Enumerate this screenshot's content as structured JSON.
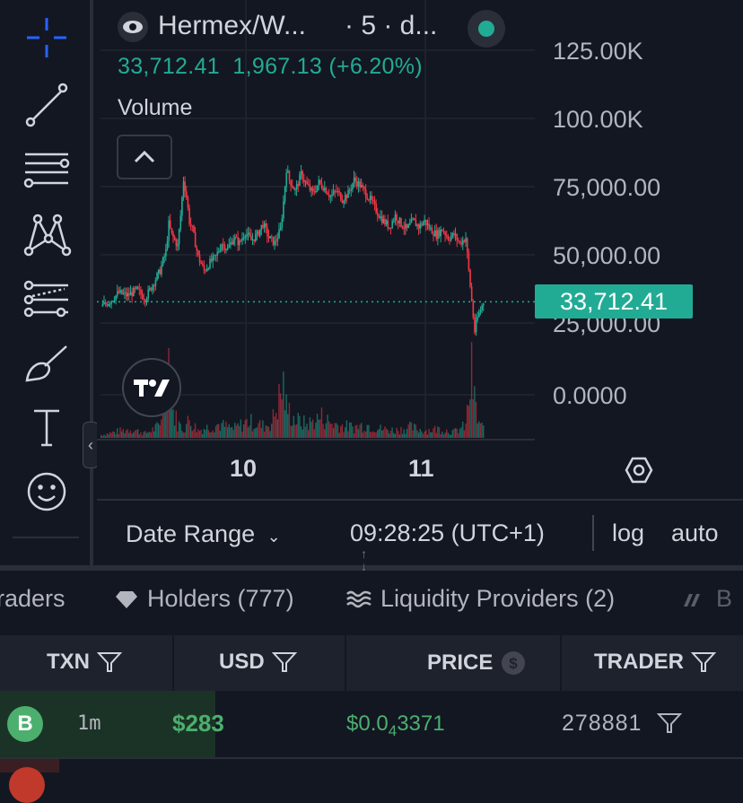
{
  "header": {
    "symbol": "Hermex/W...",
    "interval": "· 5 · d...",
    "price": "33,712.41",
    "change": "1,967.13 (+6.20%)",
    "volume_label": "Volume"
  },
  "y_axis": {
    "labels": [
      "125.00K",
      "100.00K",
      "75,000.00",
      "50,000.00",
      "25,000.00",
      "0.0000"
    ],
    "last_price_tag": "33,712.41"
  },
  "x_axis": {
    "labels": [
      "10",
      "11"
    ]
  },
  "bottom_bar": {
    "date_range": "Date Range",
    "time": "09:28:25 (UTC+1)",
    "log": "log",
    "auto": "auto"
  },
  "tabs": [
    {
      "label": "raders"
    },
    {
      "label": "Holders (777)"
    },
    {
      "label": "Liquidity Providers (2)"
    },
    {
      "label": "B"
    }
  ],
  "table": {
    "columns": [
      "TXN",
      "USD",
      "PRICE",
      "TRADER"
    ],
    "rows": [
      {
        "side": "B",
        "age": "1m",
        "usd": "$283",
        "price_main": "$0.0",
        "price_sub": "4",
        "price_tail": "3371",
        "trader": "278881"
      }
    ]
  },
  "colors": {
    "background": "#131722",
    "up": "#22ab94",
    "down": "#f23645",
    "buy": "#4caf6e",
    "accent_blue": "#2962ff"
  },
  "icons": {
    "toolbar": [
      "crosshair-icon",
      "trend-line-icon",
      "fib-retracement-icon",
      "pattern-icon",
      "prediction-icon",
      "brush-icon",
      "text-icon",
      "emoji-icon"
    ]
  },
  "chart_data": {
    "type": "candlestick",
    "title": "",
    "xlabel": "",
    "ylabel": "",
    "x_ticks": [
      "10",
      "11"
    ],
    "ylim": [
      0,
      125000
    ],
    "last_price": 33712.41,
    "price_path": [
      [
        0,
        32000
      ],
      [
        3,
        34000
      ],
      [
        6,
        37000
      ],
      [
        9,
        36000
      ],
      [
        12,
        38000
      ],
      [
        15,
        35000
      ],
      [
        18,
        41000
      ],
      [
        20,
        45000
      ],
      [
        22,
        52000
      ],
      [
        23,
        62000
      ],
      [
        24,
        58000
      ],
      [
        26,
        54000
      ],
      [
        27,
        65000
      ],
      [
        28,
        78000
      ],
      [
        29,
        72000
      ],
      [
        30,
        63000
      ],
      [
        31,
        60000
      ],
      [
        33,
        50000
      ],
      [
        35,
        45000
      ],
      [
        37,
        48000
      ],
      [
        39,
        50000
      ],
      [
        41,
        55000
      ],
      [
        43,
        53000
      ],
      [
        45,
        57000
      ],
      [
        47,
        55000
      ],
      [
        49,
        59000
      ],
      [
        51,
        56000
      ],
      [
        53,
        58000
      ],
      [
        55,
        62000
      ],
      [
        57,
        57000
      ],
      [
        59,
        55000
      ],
      [
        61,
        60000
      ],
      [
        62,
        70000
      ],
      [
        63,
        82000
      ],
      [
        64,
        78000
      ],
      [
        66,
        74000
      ],
      [
        68,
        80000
      ],
      [
        70,
        76000
      ],
      [
        72,
        73000
      ],
      [
        74,
        77000
      ],
      [
        76,
        75000
      ],
      [
        78,
        72000
      ],
      [
        80,
        74000
      ],
      [
        82,
        71000
      ],
      [
        84,
        73000
      ],
      [
        86,
        78000
      ],
      [
        88,
        76000
      ],
      [
        90,
        73000
      ],
      [
        92,
        70000
      ],
      [
        94,
        66000
      ],
      [
        96,
        63000
      ],
      [
        98,
        61000
      ],
      [
        100,
        65000
      ],
      [
        102,
        62000
      ],
      [
        104,
        60000
      ],
      [
        106,
        63000
      ],
      [
        108,
        61000
      ],
      [
        110,
        63000
      ],
      [
        112,
        60000
      ],
      [
        114,
        58000
      ],
      [
        116,
        60000
      ],
      [
        118,
        57000
      ],
      [
        120,
        58000
      ],
      [
        122,
        55000
      ],
      [
        124,
        57000
      ],
      [
        125,
        45000
      ],
      [
        126,
        34000
      ],
      [
        127,
        23000
      ],
      [
        128,
        28000
      ],
      [
        129,
        31000
      ],
      [
        130,
        33712
      ]
    ],
    "volume_path": [
      [
        0,
        2
      ],
      [
        5,
        4
      ],
      [
        10,
        6
      ],
      [
        15,
        3
      ],
      [
        20,
        8
      ],
      [
        23,
        55
      ],
      [
        24,
        20
      ],
      [
        26,
        10
      ],
      [
        28,
        6
      ],
      [
        30,
        12
      ],
      [
        33,
        5
      ],
      [
        36,
        7
      ],
      [
        40,
        9
      ],
      [
        45,
        6
      ],
      [
        50,
        11
      ],
      [
        55,
        8
      ],
      [
        58,
        10
      ],
      [
        62,
        35
      ],
      [
        63,
        20
      ],
      [
        66,
        12
      ],
      [
        70,
        9
      ],
      [
        75,
        14
      ],
      [
        78,
        10
      ],
      [
        82,
        8
      ],
      [
        86,
        7
      ],
      [
        90,
        9
      ],
      [
        95,
        6
      ],
      [
        100,
        5
      ],
      [
        105,
        7
      ],
      [
        110,
        5
      ],
      [
        115,
        6
      ],
      [
        120,
        4
      ],
      [
        124,
        8
      ],
      [
        126,
        42
      ],
      [
        127,
        25
      ],
      [
        128,
        12
      ],
      [
        130,
        6
      ]
    ]
  }
}
